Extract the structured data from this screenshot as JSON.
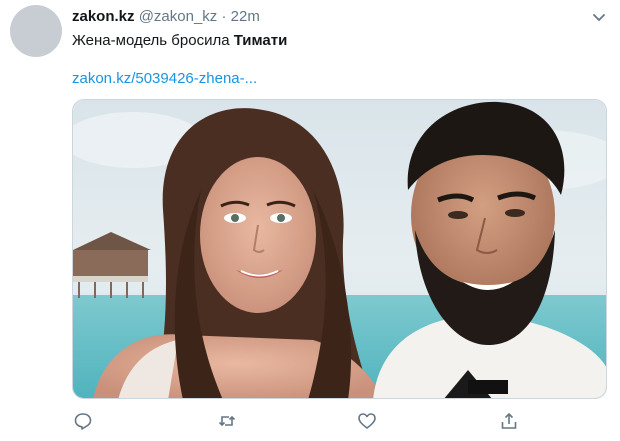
{
  "tweet": {
    "display_name": "zakon.kz",
    "handle": "@zakon_kz",
    "separator": "·",
    "time": "22m",
    "text_before": "Жена-модель бросила",
    "text_bold": "Тимати",
    "link": "zakon.kz/5039426-zhena-..."
  },
  "icons": {
    "avatar": "avatar-placeholder",
    "menu": "chevron-down-icon",
    "reply": "reply-icon",
    "retweet": "retweet-icon",
    "like": "heart-icon",
    "share": "share-icon"
  },
  "colors": {
    "link": "#1b95e0",
    "muted": "#657786",
    "text": "#14171a"
  }
}
